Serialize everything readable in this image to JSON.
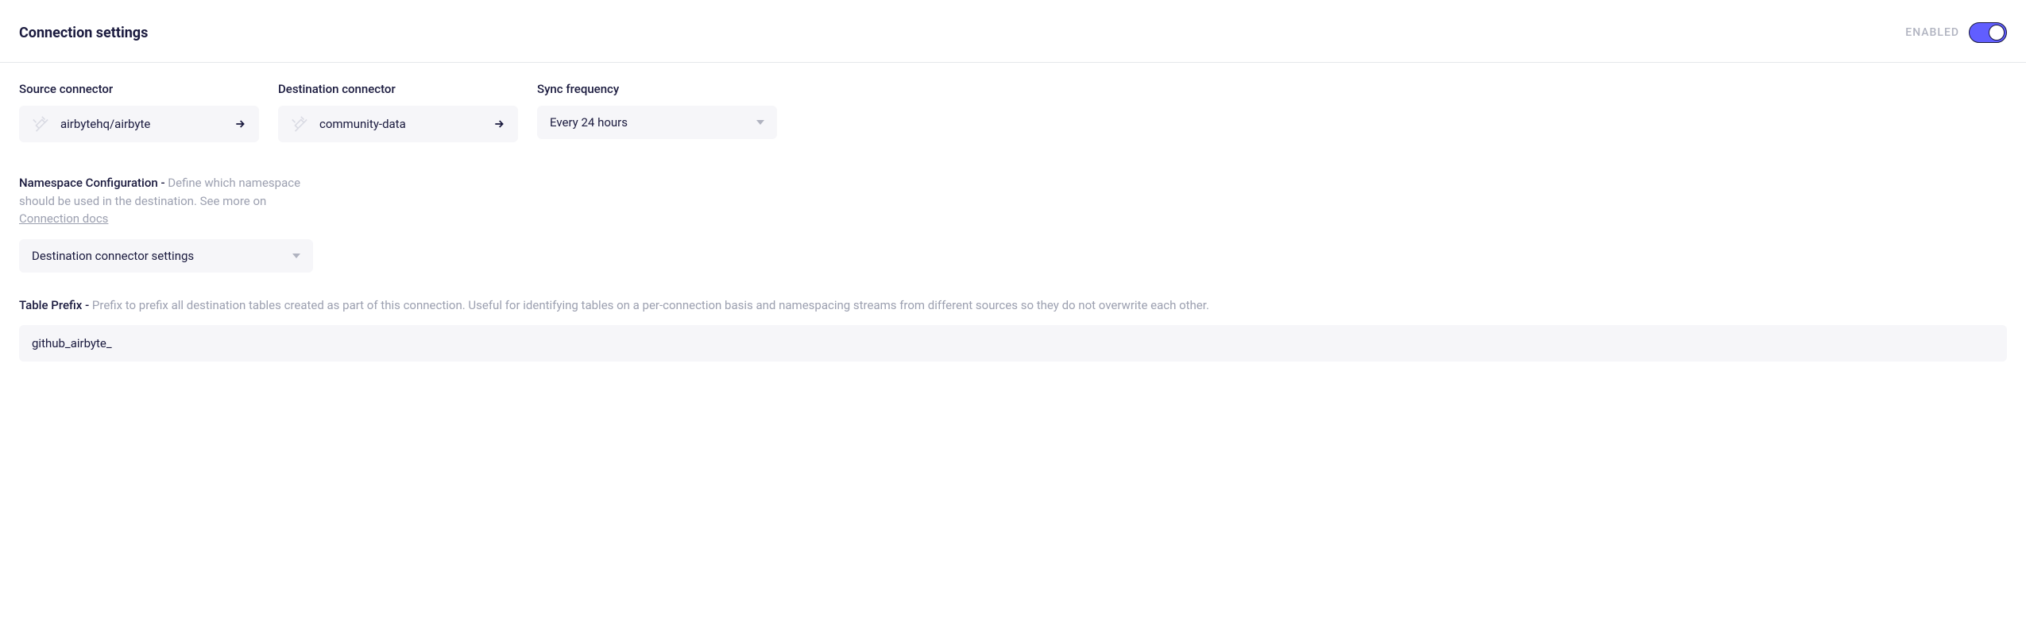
{
  "header": {
    "title": "Connection settings",
    "enabled_label": "ENABLED",
    "enabled": true
  },
  "fields": {
    "source": {
      "label": "Source connector",
      "value": "airbytehq/airbyte"
    },
    "destination": {
      "label": "Destination connector",
      "value": "community-data"
    },
    "sync_frequency": {
      "label": "Sync frequency",
      "value": "Every 24 hours"
    }
  },
  "namespace": {
    "heading_strong": "Namespace Configuration - ",
    "heading_muted_1": "Define which namespace should be used in the destination. See more on ",
    "heading_link": "Connection docs",
    "value": "Destination connector settings"
  },
  "table_prefix": {
    "heading_strong": "Table Prefix - ",
    "heading_muted": "Prefix to prefix all destination tables created as part of this connection. Useful for identifying tables on a per-connection basis and namespacing streams from different sources so they do not overwrite each other.",
    "value": "github_airbyte_"
  }
}
